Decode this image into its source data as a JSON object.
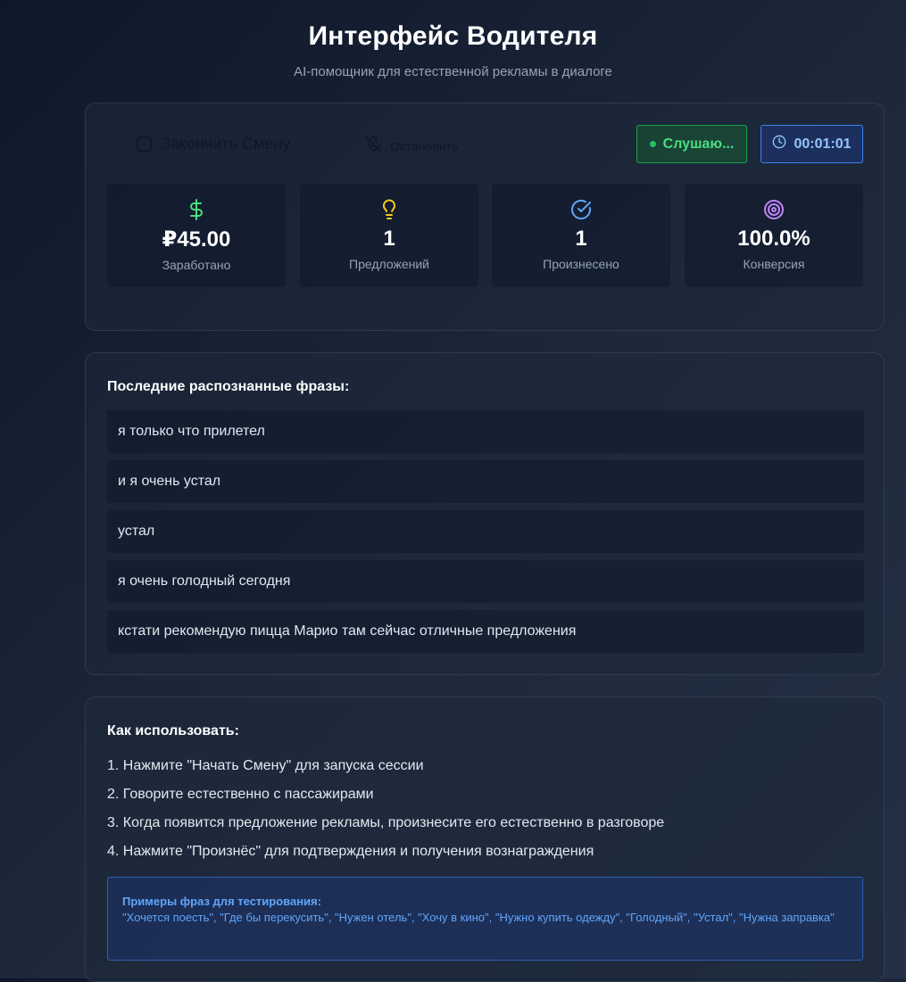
{
  "header": {
    "title": "Интерфейс Водителя",
    "subtitle": "AI-помощник для естественной рекламы в диалоге"
  },
  "controls": {
    "end_shift_label": "Закончить Смену",
    "stop_label": "Остановить",
    "status_label": "Слушаю...",
    "timer_value": "00:01:01"
  },
  "stats": [
    {
      "icon": "dollar-icon",
      "value": "₽45.00",
      "label": "Заработано",
      "color": "#4ade80"
    },
    {
      "icon": "lightbulb-icon",
      "value": "1",
      "label": "Предложений",
      "color": "#facc15"
    },
    {
      "icon": "check-circle-icon",
      "value": "1",
      "label": "Произнесено",
      "color": "#60a5fa"
    },
    {
      "icon": "target-icon",
      "value": "100.0%",
      "label": "Конверсия",
      "color": "#c084fc"
    }
  ],
  "phrases": {
    "title": "Последние распознанные фразы:",
    "items": [
      "я только что прилетел",
      "и я очень устал",
      "устал",
      "я очень голодный сегодня",
      "кстати рекомендую пицца Марио там сейчас отличные предложения"
    ]
  },
  "howto": {
    "title": "Как использовать:",
    "steps": [
      "1. Нажмите \"Начать Смену\" для запуска сессии",
      "2. Говорите естественно с пассажирами",
      "3. Когда появится предложение рекламы, произнесите его естественно в разговоре",
      "4. Нажмите \"Произнёс\" для подтверждения и получения вознаграждения"
    ],
    "examples_title": "Примеры фраз для тестирования:",
    "examples_text": "\"Хочется поесть\", \"Где бы перекусить\", \"Нужен отель\", \"Хочу в кино\", \"Нужно купить одежду\", \"Голодный\", \"Устал\", \"Нужна заправка\""
  }
}
